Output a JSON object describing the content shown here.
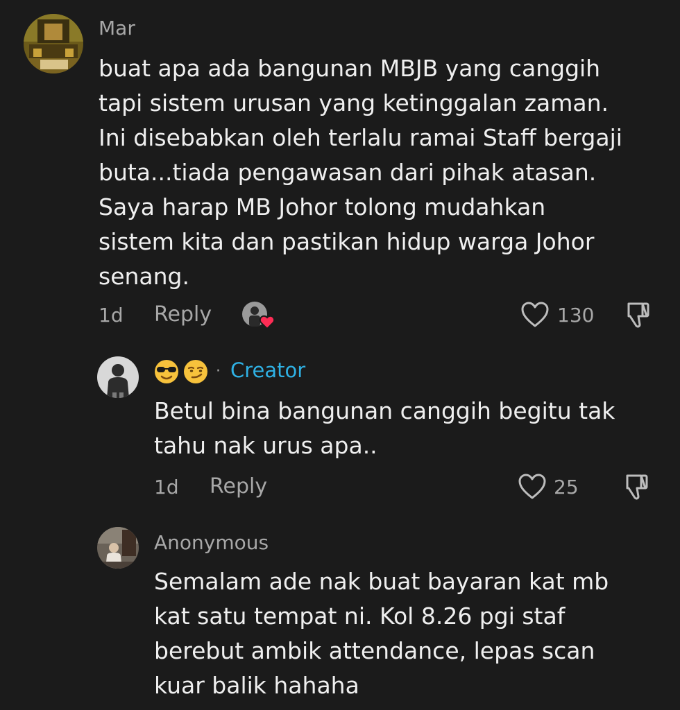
{
  "comments": [
    {
      "username": "Mar",
      "text": "buat apa ada bangunan MBJB yang canggih\ntapi sistem urusan yang ketinggalan zaman.\nIni disebabkan oleh terlalu ramai Staff bergaji\nbuta...tiada pengawasan dari pihak atasan.\nSaya harap MB Johor tolong mudahkan\nsistem kita dan pastikan hidup warga Johor\nsenang.",
      "time": "1d",
      "reply_label": "Reply",
      "likes": "130"
    },
    {
      "creator_label": "Creator",
      "separator": "·",
      "text": "Betul bina bangunan canggih begitu tak\ntahu nak urus apa..",
      "time": "1d",
      "reply_label": "Reply",
      "likes": "25"
    },
    {
      "username": "Anonymous",
      "text": "Semalam ade nak buat bayaran kat mb\nkat satu tempat ni. Kol 8.26 pgi staf\nberebut ambik attendance, lepas scan\nkuar balik hahaha"
    }
  ],
  "icons": {
    "like": "heart-outline-icon",
    "dislike": "thumbs-down-icon",
    "creator_liked": "creator-heart-avatar-icon"
  },
  "colors": {
    "background": "#1b1b1b",
    "text": "#efefef",
    "muted": "#a8a8a8",
    "creator": "#2fb1e4",
    "heart": "#fe2c55"
  }
}
